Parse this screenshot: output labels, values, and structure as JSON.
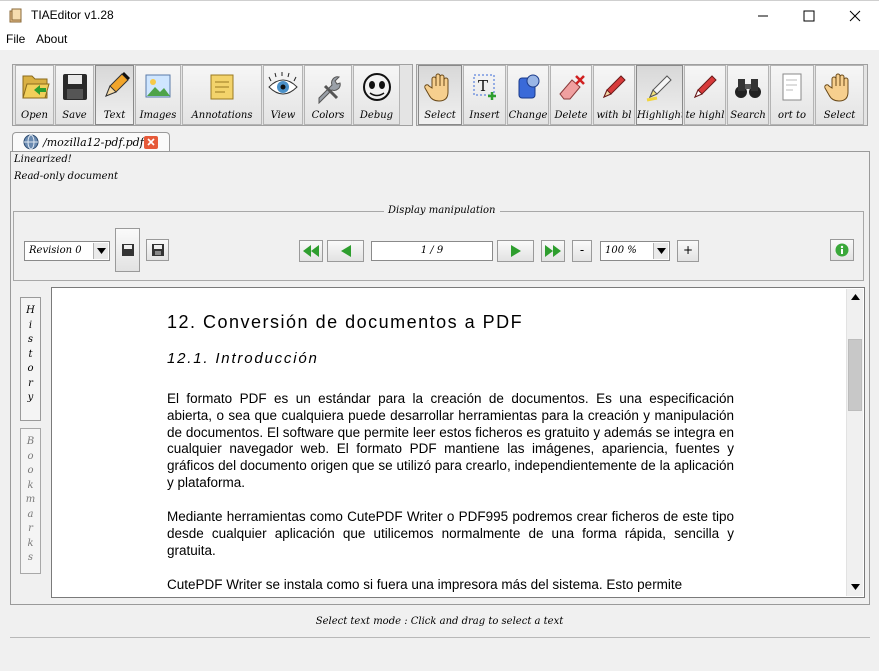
{
  "window": {
    "title": "TIAEditor v1.28",
    "controls": {
      "minimize": "minimize-icon",
      "maximize": "maximize-icon",
      "close": "close-icon"
    }
  },
  "menu": [
    "File",
    "About"
  ],
  "toolbar": {
    "groups_left": [
      {
        "label": "Open",
        "icon": "folder-open-icon"
      },
      {
        "label": "Save",
        "icon": "floppy-disk-icon"
      },
      {
        "label": "Text",
        "icon": "pencil-icon",
        "active": true
      },
      {
        "label": "Images",
        "icon": "image-icon"
      },
      {
        "label": "Annotations",
        "icon": "sticky-note-icon"
      },
      {
        "label": "View",
        "icon": "eye-icon"
      },
      {
        "label": "Colors",
        "icon": "wrench-icon"
      },
      {
        "label": "Debug",
        "icon": "bug-icon"
      }
    ],
    "groups_right": [
      {
        "label": "Select",
        "icon": "hand-icon",
        "active": true
      },
      {
        "label": "Insert",
        "icon": "text-insert-icon"
      },
      {
        "label": "Change",
        "icon": "change-icon"
      },
      {
        "label": "Delete",
        "icon": "eraser-icon"
      },
      {
        "label": "with bl",
        "icon": "marker-icon"
      },
      {
        "label": "Highlight",
        "icon": "highlighter-icon",
        "active": true
      },
      {
        "label": "te highl",
        "icon": "marker-erase-icon"
      },
      {
        "label": "Search",
        "icon": "binoculars-icon"
      },
      {
        "label": "ort to",
        "icon": "export-icon"
      },
      {
        "label": "Select",
        "icon": "hand-icon"
      }
    ]
  },
  "tab": {
    "label": "/mozilla12-pdf.pdf"
  },
  "info": [
    "Linearized!",
    "Read-only document"
  ],
  "display": {
    "legend": "Display manipulation",
    "revision": "Revision 0",
    "page": "1 / 9",
    "zoom": "100 %",
    "minus": "-",
    "plus": "+"
  },
  "side_tabs": {
    "history": [
      "H",
      "i",
      "s",
      "t",
      "o",
      "r",
      "y"
    ],
    "bookmarks": [
      "B",
      "o",
      "o",
      "k",
      "m",
      "a",
      "r",
      "k",
      "s"
    ]
  },
  "document": {
    "h1": "12. Conversión de documentos a PDF",
    "h2": "12.1. Introducción",
    "p1": "El formato PDF es un estándar para la creación de documentos. Es una especificación abierta, o sea que cualquiera puede desarrollar herramientas para la creación y manipulación de documentos. El software que permite leer estos ficheros es gratuito y además se integra en cualquier navegador web. El formato PDF mantiene las imágenes, apariencia, fuentes y gráficos del documento origen que se utilizó para crearlo, independientemente de la aplicación y plataforma.",
    "p2": "Mediante herramientas como CutePDF Writer o PDF995 podremos crear ficheros de este tipo desde cualquier aplicación que utilicemos normalmente de una forma rápida, sencilla y gratuita.",
    "p3": "CutePDF Writer se instala como si fuera una impresora más del sistema. Esto permite"
  },
  "status": "Select text mode : Click and drag to select a text",
  "colors": {
    "accent_green": "#2e9e2e",
    "tab_close": "#e65a3a"
  }
}
